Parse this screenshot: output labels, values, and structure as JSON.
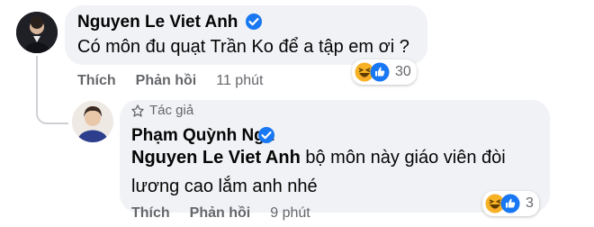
{
  "comments": [
    {
      "author": "Nguyen Le Viet Anh",
      "text": "Có môn đu quạt Trần Ko để a tập em ơi ?",
      "actions": {
        "like": "Thích",
        "reply": "Phản hồi",
        "time": "11 phút"
      },
      "reactions": {
        "count": "30",
        "types": [
          "haha-icon",
          "like-icon"
        ]
      }
    },
    {
      "badge": "Tác giả",
      "author": "Phạm Quỳnh Nga",
      "mention": "Nguyen Le Viet Anh",
      "text": " bộ môn này giáo viên đòi lương cao lắm anh nhé",
      "actions": {
        "like": "Thích",
        "reply": "Phản hồi",
        "time": "9 phút"
      },
      "reactions": {
        "count": "3",
        "types": [
          "haha-icon",
          "like-icon"
        ]
      }
    }
  ],
  "colors": {
    "bubble": "#f0f2f5",
    "text": "#050505",
    "secondary": "#65676b",
    "verified": "#1877f2",
    "like": "#1877f2",
    "haha": "#f7b125"
  }
}
